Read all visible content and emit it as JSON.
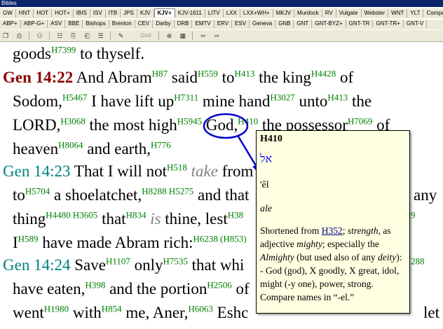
{
  "window": {
    "title": "Bibles"
  },
  "tabs_row1": [
    "GW",
    "HNT",
    "HOT",
    "HOT+",
    "IBIS",
    "ISV",
    "ITB",
    "JPS",
    "KJV",
    "KJV+",
    "KJV-1611",
    "LITV",
    "LXX",
    "LXX+WH+",
    "MKJV",
    "Murdock",
    "RV",
    "Vulgate",
    "Webster",
    "WNT",
    "YLT",
    "Compare"
  ],
  "tabs_row2": [
    "ABP+",
    "ABP-G+",
    "ASV",
    "BBE",
    "Bishops",
    "Brenton",
    "CEV",
    "Darby",
    "DRB",
    "EMTV",
    "ERV",
    "ESV",
    "Geneva",
    "GNB",
    "GNT",
    "GNT-BYZ+",
    "GNT-TR",
    "GNT-TR+",
    "GNT-V"
  ],
  "active_tab": "KJV+",
  "toolbar": {
    "dropdown1": "",
    "dropdown2": "God"
  },
  "colors": {
    "reference": "#008080",
    "current_reference": "#8b0000",
    "strongs": "#008000",
    "circle": "#0000cc",
    "popup_bg": "#ffffe1"
  },
  "text": {
    "l0": {
      "a": "goods",
      "s1": "H7399",
      "b": " to thyself."
    },
    "l1": {
      "ref": "Gen 14:22",
      "a": " And Abram",
      "s1": "H87",
      "b": " said",
      "s2": "H559",
      "c": " to",
      "s3": "H413",
      "d": " the king",
      "s4": "H4428",
      "e": " of"
    },
    "l2": {
      "a": "Sodom,",
      "s1": "H5467",
      "b": " I have lift up",
      "s2": "H7311",
      "c": " mine hand",
      "s3": "H3027",
      "d": " unto",
      "s4": "H413",
      "e": " the"
    },
    "l3": {
      "a": "LORD,",
      "s1": "H3068",
      "b": " the most high",
      "s2": "H5945",
      "c": " God,",
      "s3": "H410",
      "d": " the possessor",
      "s4": "H7069",
      "e": " of"
    },
    "l4": {
      "a": "heaven",
      "s1": "H8064",
      "b": " and earth,",
      "s2": "H776"
    },
    "l5": {
      "ref": "Gen 14:23",
      "a": "  That I will not",
      "s1": "H518",
      "it": " take",
      "b": " from"
    },
    "l6": {
      "a": "to",
      "s1": "H5704",
      "b": " a shoelatchet,",
      "s2": "H8288 H5275",
      "c": " and that",
      "d": "any"
    },
    "l7": {
      "a": "thing",
      "s1": "H4480 H3605",
      "b": " that",
      "s2": "H834",
      "it": " is",
      "c": " thine, lest",
      "s3": "H38",
      "s4": "9"
    },
    "l8": {
      "a": "I",
      "s1": "H589",
      "b": " have made Abram rich:",
      "s2": "H6238 (H853)"
    },
    "l9": {
      "ref": "Gen 14:24",
      "a": "  Save",
      "s1": "H1107",
      "b": " only",
      "s2": "H7535",
      "c": " that whi",
      "s3": "288"
    },
    "l10": {
      "a": "have eaten,",
      "s1": "H398",
      "b": " and the portion",
      "s2": "H2506",
      "c": " of"
    },
    "l11": {
      "a": "went",
      "s1": "H1980",
      "b": " with",
      "s2": "H854",
      "c": " me, Aner,",
      "s3": "H6063",
      "d": " Eshc",
      "e": "let"
    }
  },
  "popup": {
    "number": "H410",
    "hebrew": "אל",
    "translit": "'êl",
    "pron": "ale",
    "def_a": "Shortened from ",
    "def_link": "H352",
    "def_b": "; ",
    "def_c": "strength",
    "def_d": ", as adjective ",
    "def_e": "mighty",
    "def_f": "; especially the ",
    "def_g": "Almighty",
    "def_h": " (but used also of any ",
    "def_i": "deity",
    "def_j": "): - God (god), X goodly, X great, idol, might (-y one), power, strong. Compare names in “-el.”"
  }
}
